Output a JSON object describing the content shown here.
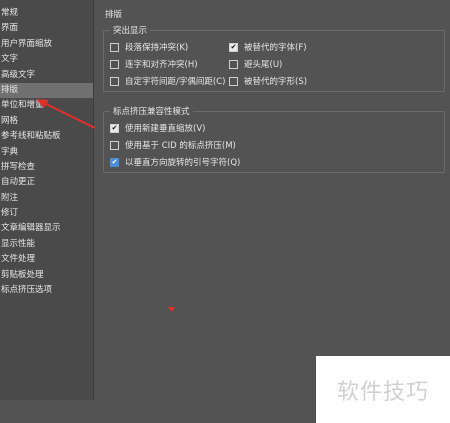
{
  "nav": {
    "items": [
      {
        "label": "常规",
        "selected": false
      },
      {
        "label": "界面",
        "selected": false
      },
      {
        "label": "用户界面缩放",
        "selected": false
      },
      {
        "label": "文字",
        "selected": false
      },
      {
        "label": "高级文字",
        "selected": false
      },
      {
        "label": "排版",
        "selected": true
      },
      {
        "label": "单位和增量",
        "selected": false
      },
      {
        "label": "网格",
        "selected": false
      },
      {
        "label": "参考线和粘贴板",
        "selected": false
      },
      {
        "label": "字典",
        "selected": false
      },
      {
        "label": "拼写检查",
        "selected": false
      },
      {
        "label": "自动更正",
        "selected": false
      },
      {
        "label": "附注",
        "selected": false
      },
      {
        "label": "修订",
        "selected": false
      },
      {
        "label": "文章编辑器显示",
        "selected": false
      },
      {
        "label": "显示性能",
        "selected": false
      },
      {
        "label": "文件处理",
        "selected": false
      },
      {
        "label": "剪贴板处理",
        "selected": false
      },
      {
        "label": "标点挤压选项",
        "selected": false
      }
    ]
  },
  "main": {
    "section_title": "排版",
    "highlight_group": {
      "title": "突出显示",
      "options": [
        {
          "label": "段落保持冲突(K)",
          "checked": false
        },
        {
          "label": "被替代的字体(F)",
          "checked": true
        },
        {
          "label": "连字和对齐冲突(H)",
          "checked": false
        },
        {
          "label": "避头尾(U)",
          "checked": false
        },
        {
          "label": "自定字符间距/字偶间距(C)",
          "checked": false
        },
        {
          "label": "被替代的字形(S)",
          "checked": false
        }
      ]
    },
    "compat_group": {
      "title": "标点挤压兼容性模式",
      "options": [
        {
          "label": "使用新建垂直缩放(V)",
          "checked": true
        },
        {
          "label": "使用基于 CID 的标点挤压(M)",
          "checked": false
        },
        {
          "label": "以垂直方向旋转的引号字符(Q)",
          "checked": true
        }
      ]
    }
  },
  "watermark": {
    "text": "软件技巧"
  },
  "colors": {
    "background": "#535353",
    "panel": "#4a4a4a",
    "selection": "#707070",
    "annotation_arrow": "#e0302a",
    "checkbox_accent": "#4a8fd6"
  }
}
